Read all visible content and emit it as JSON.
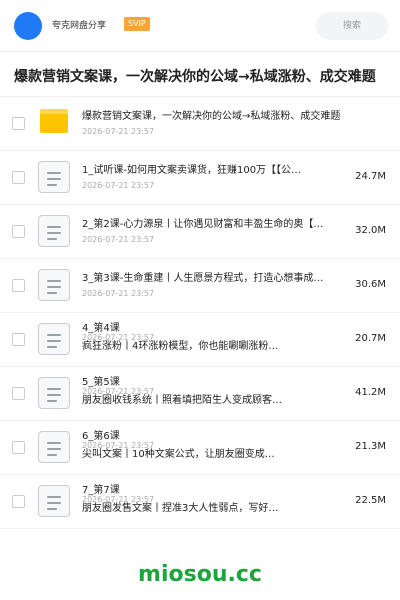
{
  "header": {
    "user_name": "夸克网盘分享",
    "badge": "SVIP",
    "search_label": "搜索"
  },
  "share": {
    "title": "爆款营销文案课，一次解决你的公域→私域涨粉、成交难题"
  },
  "items": [
    {
      "type": "folder",
      "name": "爆款营销文案课，一次解决你的公域→私域涨粉、成交难题",
      "date": "2026-07-21 23:57",
      "size": ""
    },
    {
      "type": "file",
      "name": "1_试听课-如何用文案卖课货，狂赚100万【【公…",
      "date": "2026-07-21 23:57",
      "size": "24.7M"
    },
    {
      "type": "file",
      "name": "2_第2课-心力源泉丨让你遇见财富和丰盈生命的奥【…",
      "date": "2026-07-21 23:57",
      "size": "32.0M"
    },
    {
      "type": "file",
      "name": "3_第3课-生命重建丨人生愿景方程式，打造心想事成…",
      "date": "2026-07-21 23:57",
      "size": "30.6M"
    },
    {
      "type": "file",
      "name": "4_第4课",
      "subline": "疯狂涨粉丨4环涨粉模型，你也能唰唰涨粉…",
      "date": "2026-07-21 23:57",
      "size": "20.7M"
    },
    {
      "type": "file",
      "name": "5_第5课",
      "subline": "朋友圈收钱系统丨照着填把陌生人变成顾客…",
      "date": "2026-07-21 23:57",
      "size": "41.2M"
    },
    {
      "type": "file",
      "name": "6_第6课",
      "subline": "尖叫文案丨10种文案公式，让朋友圈变成…",
      "date": "2026-07-21 23:57",
      "size": "21.3M"
    },
    {
      "type": "file",
      "name": "7_第7课",
      "subline": "朋友圈发售文案丨捏准3大人性弱点，写好…",
      "date": "2026-07-21 23:57",
      "size": "22.5M"
    }
  ],
  "watermark": "miosou.cc",
  "colors": {
    "accent": "#1e7bf5",
    "svip": "#f7a43a",
    "folder": "#ffc400",
    "watermark": "#1fa33a"
  }
}
